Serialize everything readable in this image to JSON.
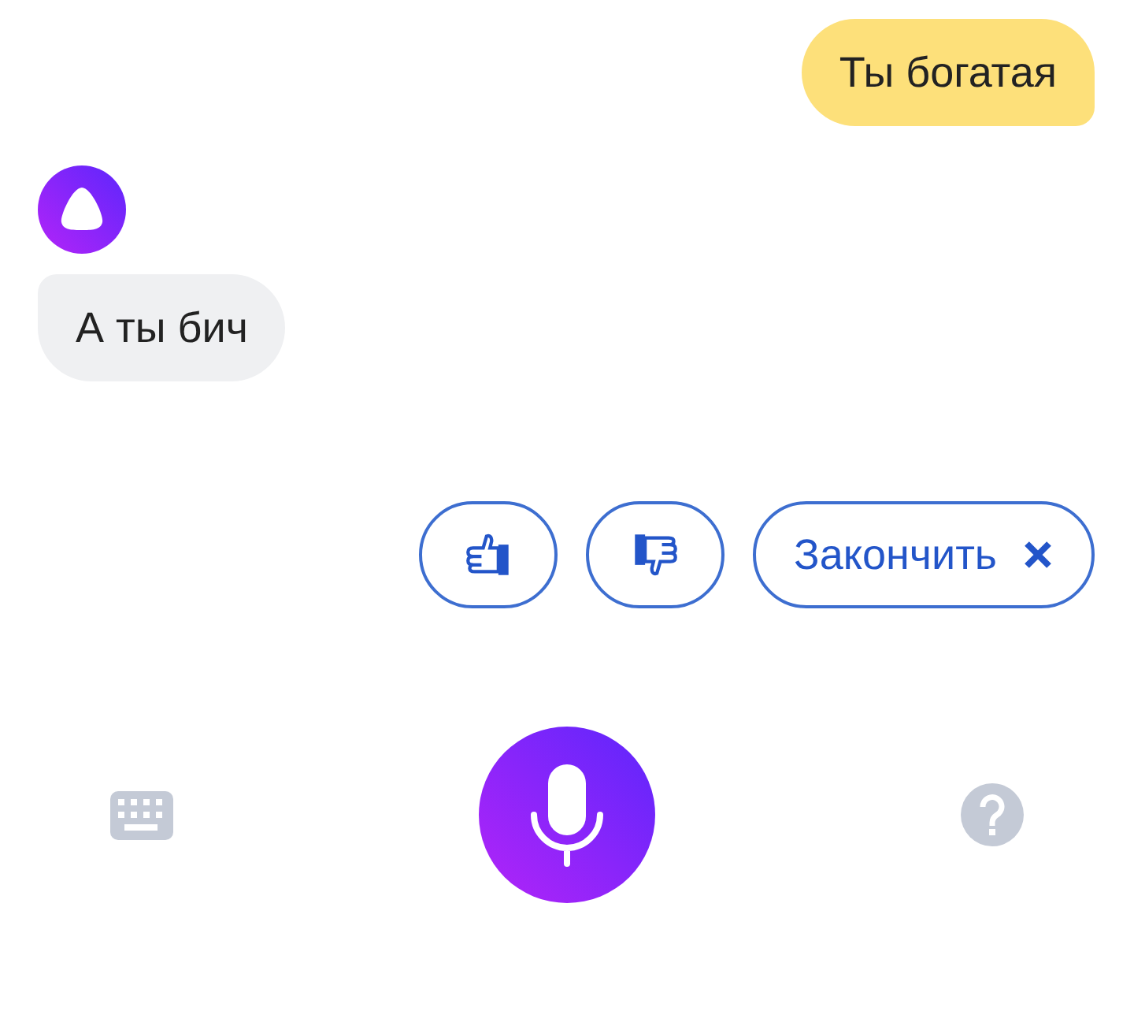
{
  "messages": [
    {
      "kind": "outgoing",
      "text": "Ты богатая"
    },
    {
      "kind": "incoming",
      "text": "А ты бич"
    }
  ],
  "suggestions": [
    {
      "kind": "like"
    },
    {
      "kind": "dislike"
    },
    {
      "kind": "close",
      "label": "Закончить"
    }
  ]
}
